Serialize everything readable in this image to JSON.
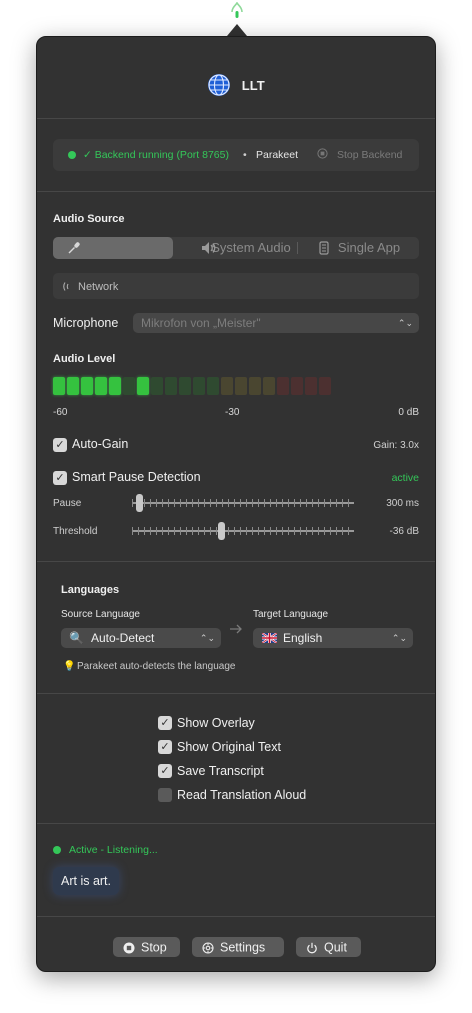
{
  "app": {
    "title": "LLT"
  },
  "status": {
    "backend_text": "✓ Backend running (Port 8765)",
    "separator": "•",
    "engine": "Parakeet",
    "stop_backend_label": "Stop Backend"
  },
  "audio_source": {
    "title": "Audio Source",
    "options": [
      "",
      "System Audio",
      "Single App"
    ],
    "selected_index": 0,
    "network_label": "Network"
  },
  "microphone": {
    "label": "Microphone",
    "value": "Mikrofon von „Meister\""
  },
  "audio_level": {
    "title": "Audio Level",
    "scale": [
      "-60",
      "-30",
      "0 dB"
    ],
    "segment_count": 20,
    "lit_segments": [
      0,
      1,
      2,
      3,
      4,
      6
    ],
    "colors": {
      "lit": "#35c23f",
      "dim_green": "#2f4a30",
      "dim_yellow": "#4a4630",
      "dim_red": "#4c3030"
    }
  },
  "auto_gain": {
    "label": "Auto-Gain",
    "checked": true,
    "gain_text": "Gain: 3.0x"
  },
  "smart_pause": {
    "label": "Smart Pause Detection",
    "checked": true,
    "status": "active",
    "pause_label": "Pause",
    "pause_value": "300 ms",
    "pause_fraction": 0.02,
    "threshold_label": "Threshold",
    "threshold_value": "-36 dB",
    "threshold_fraction": 0.4
  },
  "languages": {
    "title": "Languages",
    "source_label": "Source Language",
    "source_value": "Auto-Detect",
    "target_label": "Target Language",
    "target_value": "English",
    "hint": "Parakeet auto-detects the language"
  },
  "options": [
    {
      "label": "Show Overlay",
      "checked": true
    },
    {
      "label": "Show Original Text",
      "checked": true
    },
    {
      "label": "Save Transcript",
      "checked": true
    },
    {
      "label": "Read Translation Aloud",
      "checked": false
    }
  ],
  "activity": {
    "status": "Active - Listening...",
    "transcript": "Art is art."
  },
  "footer": {
    "stop_label": "Stop",
    "settings_label": "Settings",
    "quit_label": "Quit"
  }
}
